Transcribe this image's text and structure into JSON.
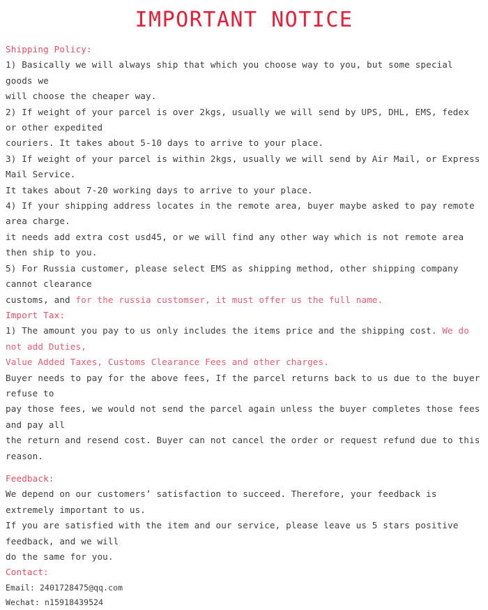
{
  "document": {
    "title": "IMPORTANT NOTICE",
    "colors": {
      "title_red": "#ec1c36",
      "heading_pink": "#ef4b64",
      "highlight_pink": "#f05a70",
      "body_text": "#3b3b3b",
      "background": "#ffffff"
    },
    "sections": [
      {
        "id": "shipping-policy",
        "heading": "Shipping Policy:",
        "lines": [
          {
            "id": "shipping-line-1a",
            "segments": [
              {
                "text": "1) Basically we will always ship that which you choose way to you, but some special goods we",
                "style": "body"
              }
            ]
          },
          {
            "id": "shipping-line-1b",
            "segments": [
              {
                "text": "will choose the cheaper way.",
                "style": "body"
              }
            ]
          },
          {
            "id": "shipping-line-2a",
            "segments": [
              {
                "text": "2) If weight of your parcel is over 2kgs, usually we will send by UPS, DHL, EMS, fedex or other expedited",
                "style": "body"
              }
            ]
          },
          {
            "id": "shipping-line-2b",
            "segments": [
              {
                "text": "couriers. It takes about 5-10 days to arrive to your place.",
                "style": "body"
              }
            ]
          },
          {
            "id": "shipping-line-3a",
            "segments": [
              {
                "text": "3) If weight of your parcel is within 2kgs, usually we will send by Air Mail, or Express Mail Service.",
                "style": "body"
              }
            ]
          },
          {
            "id": "shipping-line-3b",
            "segments": [
              {
                "text": "It takes about 7-20 working days to arrive to your place.",
                "style": "body"
              }
            ]
          },
          {
            "id": "shipping-line-4a",
            "segments": [
              {
                "text": "4) If your shipping address locates in the remote area, buyer maybe asked to pay remote area charge.",
                "style": "body"
              }
            ]
          },
          {
            "id": "shipping-line-4b",
            "segments": [
              {
                "text": "it needs add extra cost usd45, or we will find any other way which is not remote area then ship to you.",
                "style": "body"
              }
            ]
          },
          {
            "id": "shipping-line-5a",
            "segments": [
              {
                "text": "5) For Russia customer, please select EMS as shipping method, other shipping company cannot clearance",
                "style": "body"
              }
            ]
          },
          {
            "id": "shipping-line-5b",
            "segments": [
              {
                "text": "customs, and ",
                "style": "body"
              },
              {
                "text": "for the russia customser, it must offer us the full name.",
                "style": "highlight"
              }
            ]
          }
        ]
      },
      {
        "id": "import-tax",
        "heading": "Import Tax:",
        "lines": [
          {
            "id": "import-line-1a",
            "segments": [
              {
                "text": "1) The amount you pay to us only includes the items price and the shipping cost. ",
                "style": "body"
              },
              {
                "text": "We do not add Duties,",
                "style": "highlight"
              }
            ]
          },
          {
            "id": "import-line-1b",
            "segments": [
              {
                "text": "Value Added Taxes, Customs Clearance Fees and other charges.",
                "style": "highlight"
              }
            ]
          },
          {
            "id": "import-line-2a",
            "segments": [
              {
                "text": "Buyer needs to pay for the above fees, If the parcel returns back to us due to the buyer refuse to",
                "style": "body"
              }
            ]
          },
          {
            "id": "import-line-2b",
            "segments": [
              {
                "text": "pay those fees, we would not send the parcel again unless the buyer completes those fees and pay all",
                "style": "body"
              }
            ]
          },
          {
            "id": "import-line-2c",
            "segments": [
              {
                "text": "the return and resend cost. Buyer can not cancel the order or request refund due to this reason.",
                "style": "body"
              }
            ]
          }
        ]
      },
      {
        "id": "feedback",
        "heading": "Feedback:",
        "gap_before": true,
        "lines": [
          {
            "id": "feedback-line-1",
            "segments": [
              {
                "text": "We depend on our customers’ satisfaction to succeed. Therefore, your feedback is extremely important to us.",
                "style": "body"
              }
            ]
          },
          {
            "id": "feedback-line-2",
            "segments": [
              {
                "text": "If you are satisfied with the item and our service, please leave us 5 stars positive feedback, and we will",
                "style": "body"
              }
            ]
          },
          {
            "id": "feedback-line-3",
            "segments": [
              {
                "text": "do the same for you.",
                "style": "body"
              }
            ]
          }
        ]
      },
      {
        "id": "contact",
        "heading": "Contact:",
        "lines": [
          {
            "id": "contact-email",
            "small": true,
            "segments": [
              {
                "text": "Email: 2401728475@qq.com",
                "style": "body"
              }
            ]
          },
          {
            "id": "contact-wechat",
            "small": true,
            "segments": [
              {
                "text": "Wechat: n15918439524",
                "style": "body"
              }
            ]
          }
        ]
      }
    ]
  }
}
